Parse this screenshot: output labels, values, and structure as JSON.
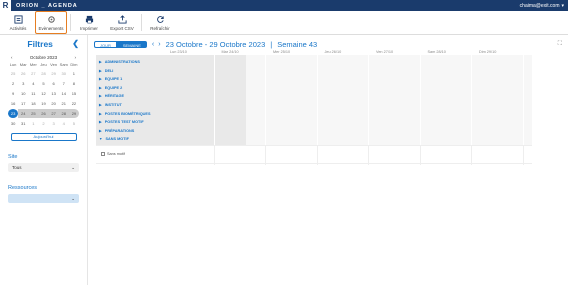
{
  "topbar": {
    "brand": "ORION _ AGENDA",
    "user": "chaima@exit.com"
  },
  "toolbar": {
    "buttons": [
      {
        "label": "Activités",
        "icon": "list-icon"
      },
      {
        "label": "Evènements",
        "icon": "gear-icon"
      },
      {
        "label": "Imprimer",
        "icon": "printer-icon"
      },
      {
        "label": "Export CSV",
        "icon": "export-icon"
      },
      {
        "label": "Refraîchir",
        "icon": "refresh-icon"
      }
    ]
  },
  "sidebar": {
    "title": "Filtres",
    "calendar": {
      "month": "Octobre 2023",
      "day_headers": [
        "Lun",
        "Mar",
        "Mer",
        "Jeu",
        "Ven",
        "Sam",
        "Dim"
      ],
      "days": [
        "25",
        "26",
        "27",
        "28",
        "29",
        "30",
        "1",
        "2",
        "3",
        "4",
        "5",
        "6",
        "7",
        "8",
        "9",
        "10",
        "11",
        "12",
        "13",
        "14",
        "15",
        "16",
        "17",
        "18",
        "19",
        "20",
        "21",
        "22",
        "23",
        "24",
        "25",
        "26",
        "27",
        "28",
        "29",
        "30",
        "31",
        "1",
        "2",
        "3",
        "4",
        "5"
      ]
    },
    "today_button": "Aujourd'hui",
    "site": {
      "label": "Site",
      "value": "Tous"
    },
    "resources": {
      "label": "Ressources",
      "value": ""
    }
  },
  "main": {
    "view_day": "JOUR",
    "view_week": "SEMAINE",
    "date_title": "23 Octobre - 29 Octobre 2023",
    "week_sep": "|",
    "week_label": "Semaine 43",
    "days": [
      "Lun 23/10",
      "Mar 24/10",
      "Mer 25/10",
      "Jeu 26/10",
      "Ven 27/10",
      "Sam 28/10",
      "Dim 29/10"
    ],
    "groups": [
      "ADMINISTRATIONS",
      "DELI",
      "EQUIPE 1",
      "EQUIPE 2",
      "HÉRITAGE",
      "INSTITUT",
      "POSTES BIOMÉTRIQUES",
      "POSTES TEST MOTIF",
      "PRÉPARATIONS",
      "SANS MOTIF"
    ],
    "empty_row_label": "Sans motif"
  },
  "colors": {
    "accent": "#1a77c9",
    "topbar": "#1a3b6c",
    "highlight": "#e67e22"
  }
}
